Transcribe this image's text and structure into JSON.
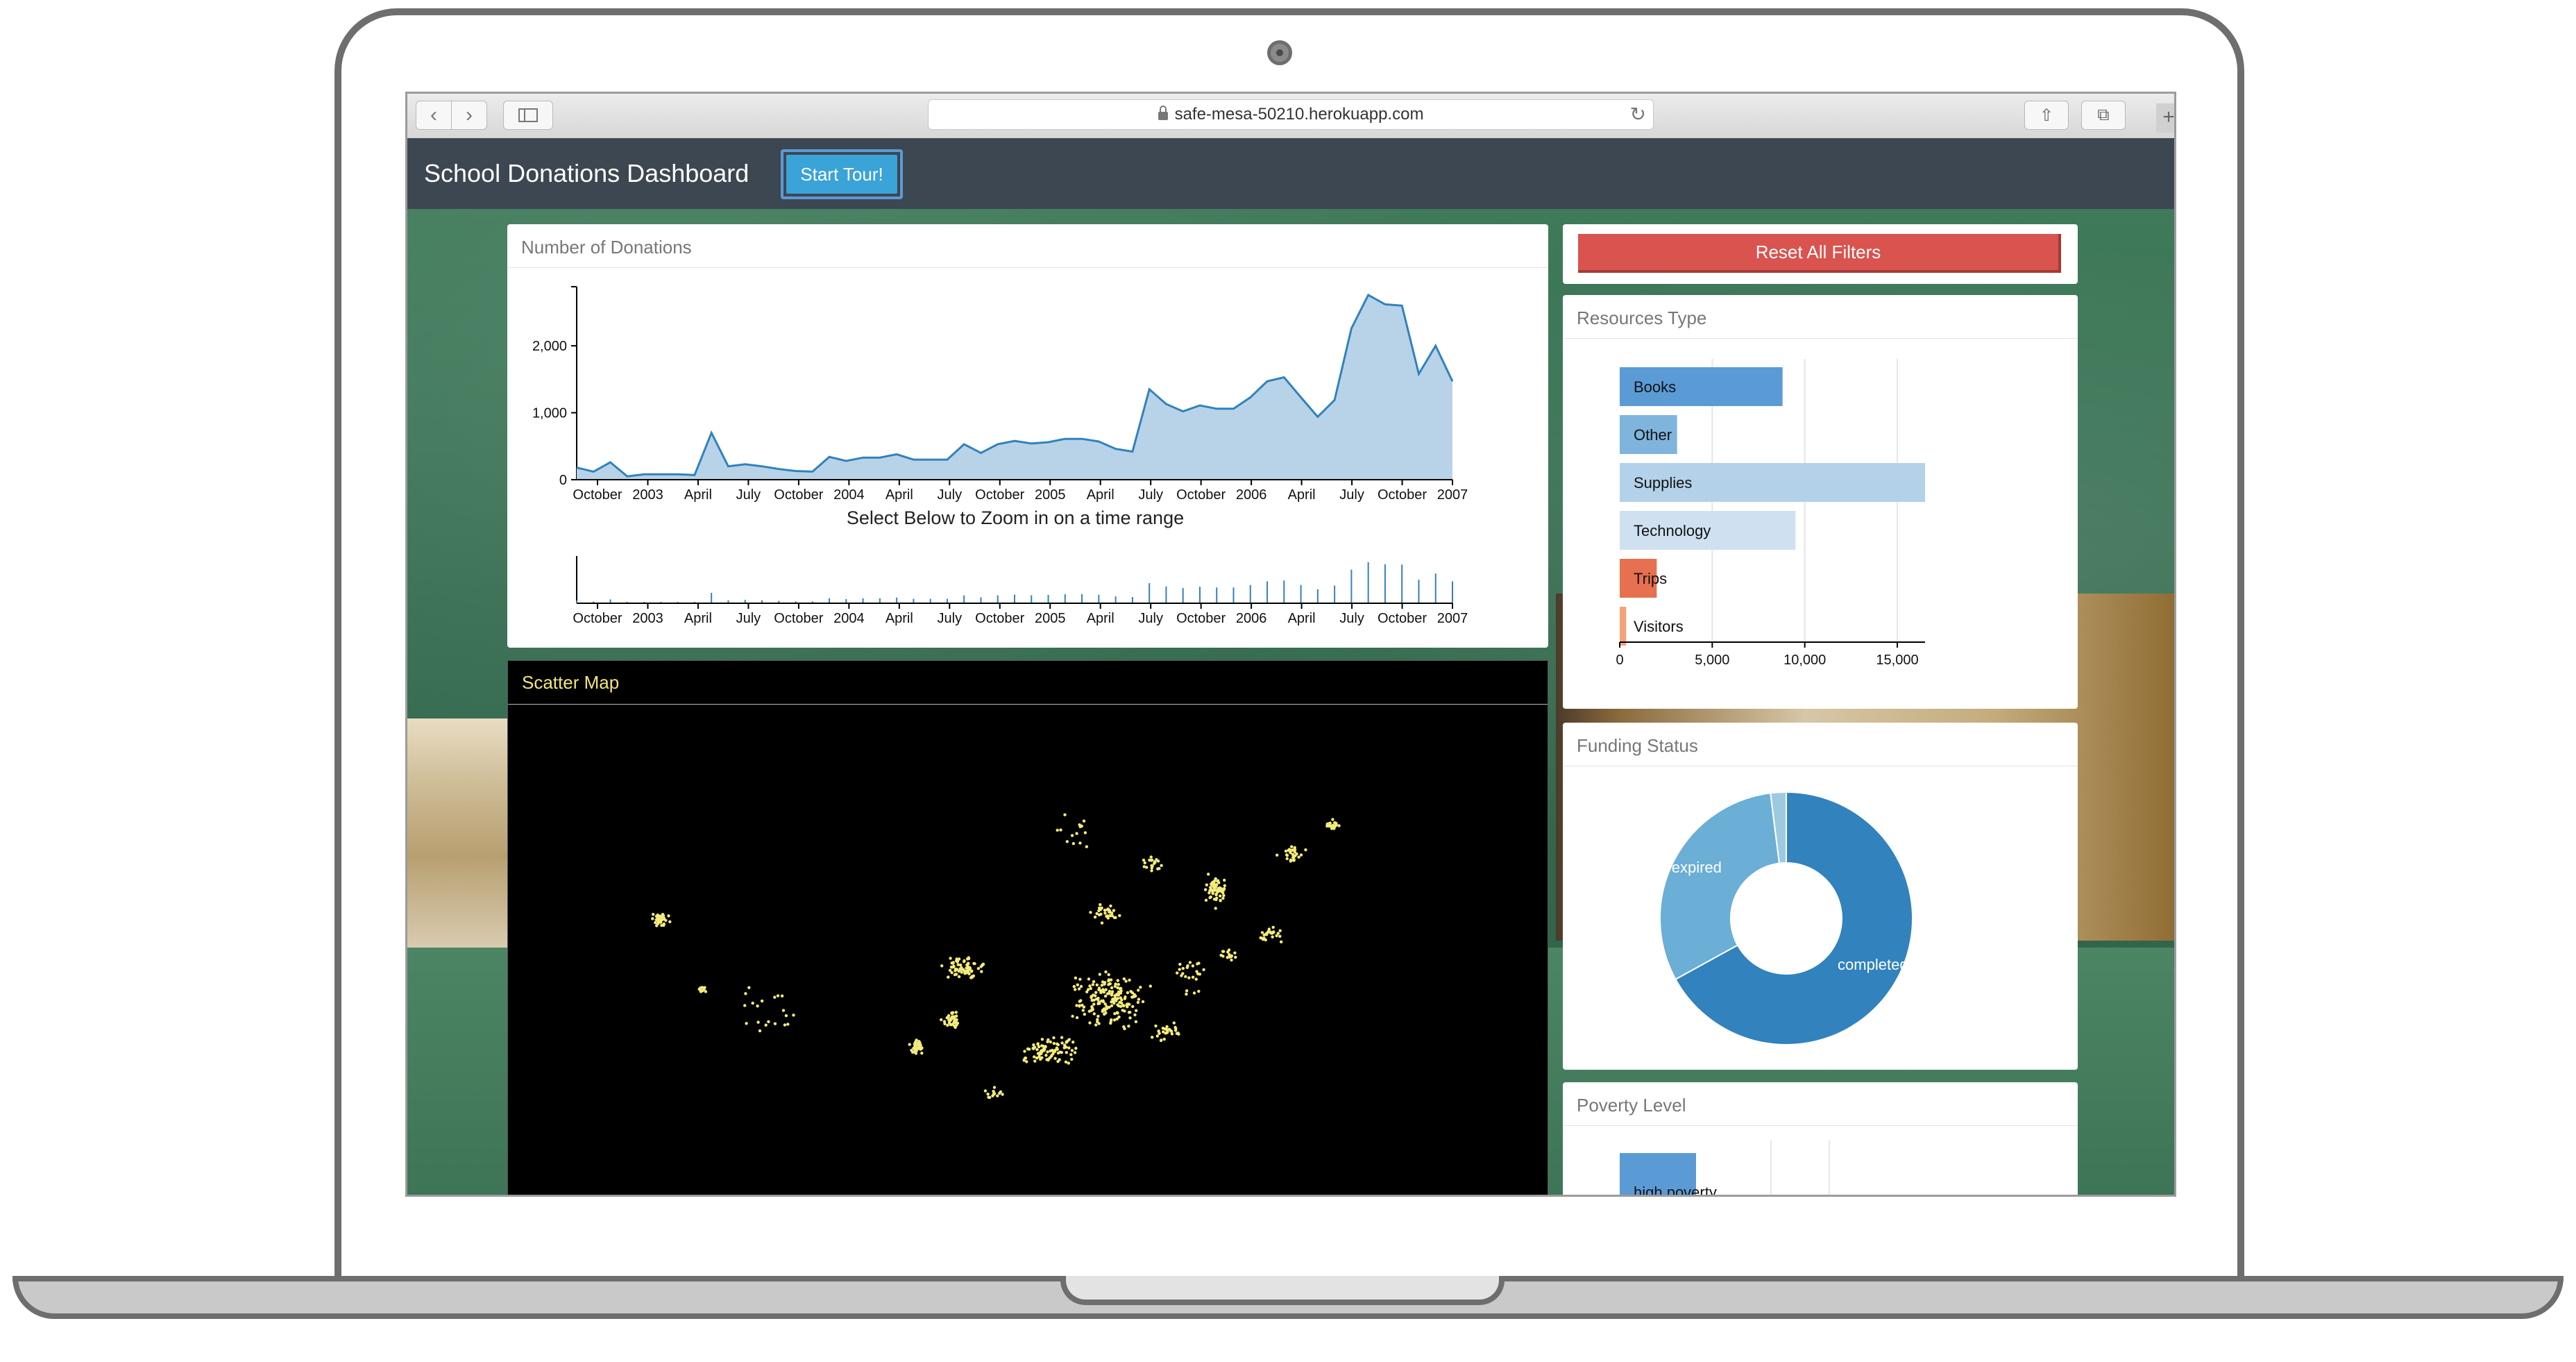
{
  "browser": {
    "url": "safe-mesa-50210.herokuapp.com"
  },
  "app": {
    "title": "School Donations Dashboard",
    "tour_label": "Start Tour!",
    "reset_label": "Reset All Filters"
  },
  "panels": {
    "donations_title": "Number of Donations",
    "zoom_caption": "Select Below to Zoom in on a time range",
    "scatter_title": "Scatter Map",
    "resources_title": "Resources Type",
    "funding_title": "Funding Status",
    "poverty_title": "Poverty Level"
  },
  "colors": {
    "area_fill": "#b8d3e8",
    "area_line": "#3182bd",
    "header": "#3c4752",
    "reset": "#d9534f",
    "scatter_point": "#f4ec7a"
  },
  "chart_data": [
    {
      "type": "area",
      "title": "Number of Donations",
      "x_ticks": [
        "October",
        "2003",
        "April",
        "July",
        "October",
        "2004",
        "April",
        "July",
        "October",
        "2005",
        "April",
        "July",
        "October",
        "2006",
        "April",
        "July",
        "October",
        "2007"
      ],
      "y_ticks": [
        "0",
        "1,000",
        "2,000"
      ],
      "ylim": [
        0,
        2800
      ],
      "values": [
        180,
        120,
        260,
        50,
        80,
        80,
        80,
        70,
        700,
        200,
        230,
        200,
        160,
        130,
        120,
        340,
        280,
        330,
        330,
        380,
        300,
        300,
        300,
        530,
        400,
        530,
        580,
        540,
        560,
        610,
        610,
        570,
        460,
        420,
        1350,
        1130,
        1020,
        1110,
        1060,
        1060,
        1230,
        1470,
        1530,
        1230,
        940,
        1190,
        2260,
        2760,
        2620,
        2600,
        1580,
        2000,
        1470
      ]
    },
    {
      "type": "bar",
      "title": "Select Below to Zoom in on a time range",
      "x_ticks": [
        "October",
        "2003",
        "April",
        "July",
        "October",
        "2004",
        "April",
        "July",
        "October",
        "2005",
        "April",
        "July",
        "October",
        "2006",
        "April",
        "July",
        "October",
        "2007"
      ]
    },
    {
      "type": "bar",
      "title": "Resources Type",
      "categories": [
        "Books",
        "Other",
        "Supplies",
        "Technology",
        "Trips",
        "Visitors"
      ],
      "values": [
        8800,
        3100,
        16500,
        9500,
        2000,
        350
      ],
      "x_ticks": [
        "0",
        "5,000",
        "10,000",
        "15,000"
      ],
      "xlim": [
        0,
        16500
      ],
      "colors": [
        "#5b9bd5",
        "#7fb4dd",
        "#b3d2e9",
        "#cfe1f1",
        "#e6704f",
        "#f4a27e"
      ]
    },
    {
      "type": "pie",
      "title": "Funding Status",
      "categories": [
        "completed",
        "expired",
        ""
      ],
      "values": [
        67,
        31,
        2
      ],
      "colors": [
        "#3182bd",
        "#6baed6",
        "#9ecae1"
      ]
    },
    {
      "type": "bar",
      "title": "Poverty Level",
      "categories": [
        "high poverty"
      ],
      "values": [
        1
      ]
    }
  ]
}
